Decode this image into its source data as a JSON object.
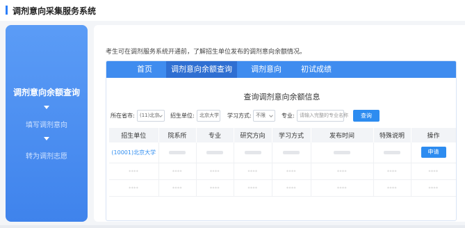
{
  "header": {
    "title": "调剂意向采集服务系统"
  },
  "steps": {
    "active": "调剂意向余额查询",
    "items": [
      "填写调剂意向",
      "转为调剂志愿"
    ]
  },
  "intro": "考生可在调剂服务系统开通前，了解招生单位发布的调剂意向余额情况。",
  "tabs": [
    "首页",
    "调剂意向余额查询",
    "调剂意向",
    "初试成绩"
  ],
  "panel_title": "查询调剂意向余额信息",
  "filters": {
    "province_label": "所在省市:",
    "province_value": "(11)北京",
    "unit_label": "招生单位:",
    "unit_value": "北京大学",
    "mode_label": "学习方式:",
    "mode_value": "不限",
    "major_label": "专业:",
    "major_placeholder": "请输入完整的专业名称",
    "query_button": "查询"
  },
  "table": {
    "headers": [
      "招生单位",
      "院系所",
      "专业",
      "研究方向",
      "学习方式",
      "发布时间",
      "特殊说明",
      "操作"
    ],
    "first_row_unit": "(10001)北京大学",
    "apply_button": "申请",
    "masked": "****"
  }
}
